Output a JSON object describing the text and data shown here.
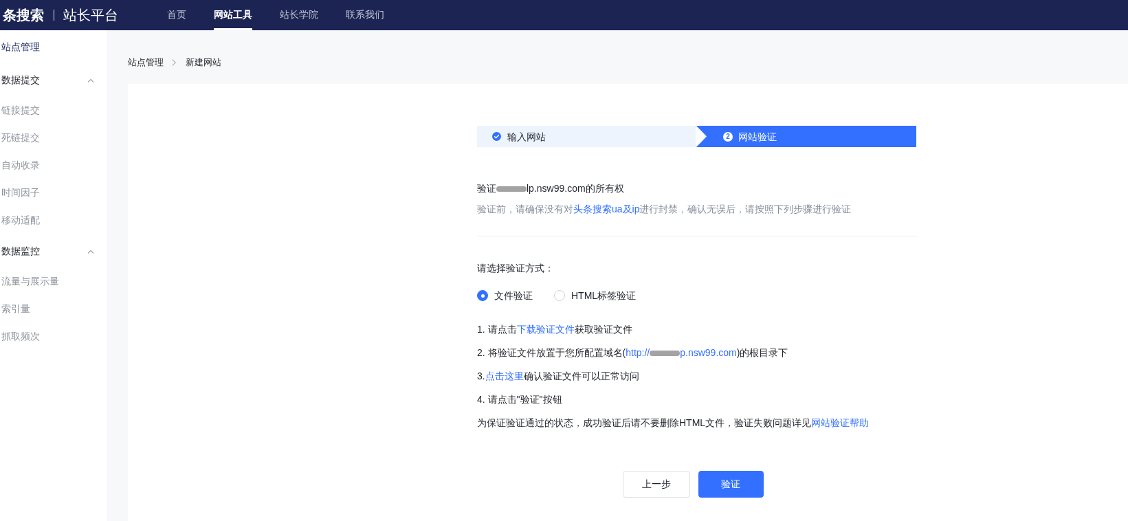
{
  "header": {
    "logo": "条搜索",
    "platform": "站长平台",
    "nav": [
      {
        "label": "首页",
        "selected": false
      },
      {
        "label": "网站工具",
        "selected": true
      },
      {
        "label": "站长学院",
        "selected": false
      },
      {
        "label": "联系我们",
        "selected": false
      }
    ]
  },
  "sidebar": {
    "items": [
      {
        "label": "站点管理",
        "selected": true
      },
      {
        "label": "数据提交",
        "selected": false,
        "expanded": true,
        "children": [
          {
            "label": "链接提交",
            "selected": false
          },
          {
            "label": "死链提交",
            "selected": false
          },
          {
            "label": "自动收录",
            "selected": false
          },
          {
            "label": "时间因子",
            "selected": false
          },
          {
            "label": "移动适配",
            "selected": false
          }
        ]
      },
      {
        "label": "数据监控",
        "selected": false,
        "expanded": true,
        "children": [
          {
            "label": "流量与展示量",
            "selected": false
          },
          {
            "label": "索引量",
            "selected": false
          },
          {
            "label": "抓取频次",
            "selected": false
          }
        ]
      }
    ]
  },
  "breadcrumb": [
    "站点管理",
    "新建网站"
  ],
  "steps": [
    {
      "label": "输入网站",
      "kind": "done"
    },
    {
      "number": "2",
      "label": "网站验证",
      "kind": "active"
    }
  ],
  "verify": {
    "title": [
      {
        "kind": "text",
        "text": "验证"
      },
      {
        "kind": "redaction"
      },
      {
        "kind": "text",
        "text": "lp.nsw99.com的所有权"
      }
    ],
    "notice": [
      {
        "kind": "text",
        "text": "验证前，请确保没有对"
      },
      {
        "kind": "link",
        "text": "头条搜索ua及ip"
      },
      {
        "kind": "text",
        "text": "进行封禁，确认无误后，请按照下列步骤进行验证"
      }
    ],
    "method_prompt": "请选择验证方式：",
    "methods": [
      {
        "label": "文件验证",
        "selected": true
      },
      {
        "label": "HTML标签验证",
        "selected": false
      }
    ],
    "instructions": [
      [
        {
          "kind": "text",
          "text": "1. 请点击"
        },
        {
          "kind": "link",
          "text": "下载验证文件"
        },
        {
          "kind": "text",
          "text": "获取验证文件"
        }
      ],
      [
        {
          "kind": "text",
          "text": "2. 将验证文件放置于您所配置域名("
        },
        {
          "kind": "link",
          "text": "http://"
        },
        {
          "kind": "redaction"
        },
        {
          "kind": "link",
          "text": "p.nsw99.com"
        },
        {
          "kind": "text",
          "text": ")的根目录下"
        }
      ],
      [
        {
          "kind": "text",
          "text": "3."
        },
        {
          "kind": "link",
          "text": "点击这里"
        },
        {
          "kind": "text",
          "text": "确认验证文件可以正常访问"
        }
      ],
      [
        {
          "kind": "text",
          "text": "4. 请点击\"验证\"按钮"
        }
      ],
      [
        {
          "kind": "text",
          "text": "为保证验证通过的状态，成功验证后请不要删除HTML文件，验证失败问题详见"
        },
        {
          "kind": "link",
          "text": "网站验证帮助"
        }
      ]
    ]
  },
  "buttons": [
    {
      "label": "上一步",
      "kind": "secondary"
    },
    {
      "label": "验证",
      "kind": "primary"
    }
  ]
}
